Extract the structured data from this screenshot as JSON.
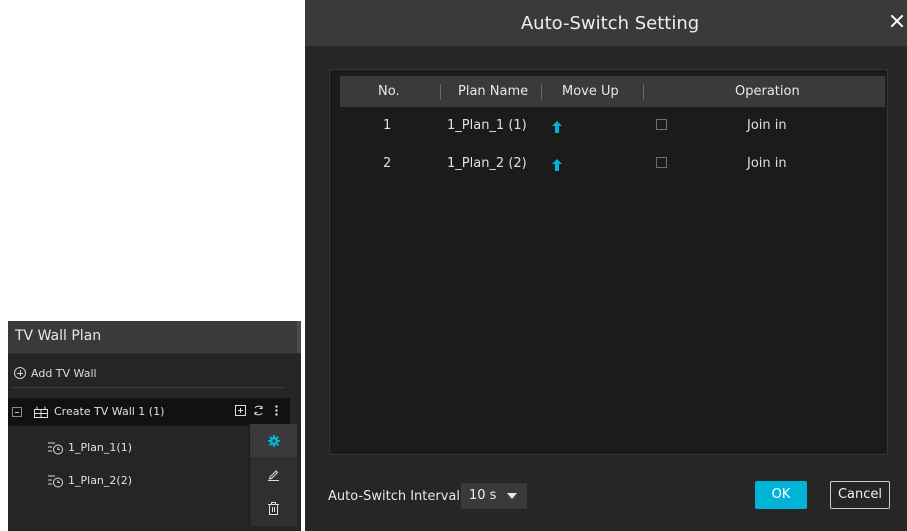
{
  "panel": {
    "title": "TV Wall Plan",
    "add_label": "Add TV Wall",
    "wall": {
      "label": "Create TV Wall 1 (1)"
    },
    "plans": [
      {
        "label": "1_Plan_1(1)"
      },
      {
        "label": "1_Plan_2(2)"
      }
    ],
    "context_menu": [
      "gear-icon",
      "edit-icon",
      "delete-icon"
    ]
  },
  "dialog": {
    "title": "Auto-Switch Setting",
    "columns": [
      "No.",
      "Plan Name",
      "Move Up",
      "Operation"
    ],
    "rows": [
      {
        "no": "1",
        "plan": "1_Plan_1 (1)",
        "operation": "Join in",
        "checked": false
      },
      {
        "no": "2",
        "plan": "1_Plan_2 (2)",
        "operation": "Join in",
        "checked": false
      }
    ],
    "interval_label": "Auto-Switch Interval",
    "interval_value": "10 s",
    "ok_label": "OK",
    "cancel_label": "Cancel"
  },
  "colors": {
    "accent": "#00b4d8",
    "dialog_bg": "#262626",
    "header_bg": "#3a3a3a",
    "table_bg": "#1b1b1b"
  }
}
